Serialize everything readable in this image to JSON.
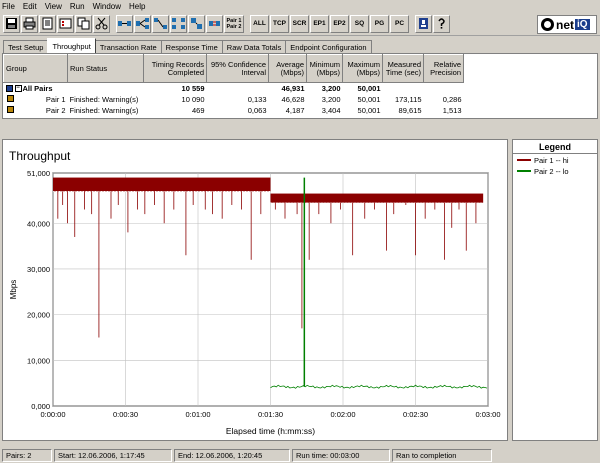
{
  "menu": [
    "File",
    "Edit",
    "View",
    "Run",
    "Window",
    "Help"
  ],
  "toolbar_text_buttons": [
    "ALL",
    "TCP",
    "SCR",
    "EP1",
    "EP2",
    "SQ",
    "PG",
    "PC"
  ],
  "toolbar_pair_button": [
    "Pair 1",
    "Pair 2"
  ],
  "logo": {
    "prefix": "net",
    "suffix": "iQ"
  },
  "tabs": [
    "Test Setup",
    "Throughput",
    "Transaction Rate",
    "Response Time",
    "Raw Data Totals",
    "Endpoint Configuration"
  ],
  "active_tab": "Throughput",
  "table": {
    "headers": [
      "Group",
      "Run Status",
      "Timing Records Completed",
      "95% Confidence Interval",
      "Average (Mbps)",
      "Minimum (Mbps)",
      "Maximum (Mbps)",
      "Measured Time (sec)",
      "Relative Precision"
    ],
    "rows": [
      {
        "group": "All Pairs",
        "status": "",
        "records": "10 559",
        "confidence": "",
        "average": "46,931",
        "minimum": "3,200",
        "maximum": "50,001",
        "time": "",
        "precision": ""
      },
      {
        "group": "Pair 1",
        "status": "Finished: Warning(s)",
        "records": "10 090",
        "confidence": "0,133",
        "average": "46,628",
        "minimum": "3,200",
        "maximum": "50,001",
        "time": "173,115",
        "precision": "0,286"
      },
      {
        "group": "Pair 2",
        "status": "Finished: Warning(s)",
        "records": "469",
        "confidence": "0,063",
        "average": "4,187",
        "minimum": "3,404",
        "maximum": "50,001",
        "time": "89,615",
        "precision": "1,513"
      }
    ]
  },
  "chart_data": {
    "type": "line",
    "title": "Throughput",
    "xlabel": "Elapsed time (h:mm:ss)",
    "ylabel": "Mbps",
    "ylim": [
      0,
      51000
    ],
    "xlim": [
      0,
      180
    ],
    "y_ticks": [
      "0,000",
      "10,000",
      "20,000",
      "30,000",
      "40,000",
      "51,000"
    ],
    "y_tick_values": [
      0,
      10000,
      20000,
      30000,
      40000,
      51000
    ],
    "x_ticks": [
      "0:00:00",
      "0:00:30",
      "0:01:00",
      "0:01:30",
      "0:02:00",
      "0:02:30",
      "0:03:00"
    ],
    "x_tick_values": [
      0,
      30,
      60,
      90,
      120,
      150,
      180
    ],
    "grid": true,
    "series": [
      {
        "name": "Pair 1 -- hi",
        "color": "#8b0000",
        "segments": [
          {
            "x_start": 0,
            "x_end": 90,
            "y_low": 47000,
            "y_high": 50000
          },
          {
            "x_start": 90,
            "x_end": 178,
            "y_low": 44500,
            "y_high": 46500
          }
        ],
        "dips": [
          [
            2,
            41000
          ],
          [
            4,
            44000
          ],
          [
            6,
            40000
          ],
          [
            9,
            37000
          ],
          [
            13,
            43000
          ],
          [
            16,
            42000
          ],
          [
            19,
            15000
          ],
          [
            24,
            41000
          ],
          [
            27,
            44000
          ],
          [
            31,
            38000
          ],
          [
            35,
            43000
          ],
          [
            38,
            42000
          ],
          [
            42,
            44000
          ],
          [
            46,
            40000
          ],
          [
            50,
            43000
          ],
          [
            55,
            33000
          ],
          [
            58,
            44000
          ],
          [
            63,
            43000
          ],
          [
            66,
            42000
          ],
          [
            70,
            41000
          ],
          [
            74,
            44000
          ],
          [
            78,
            43000
          ],
          [
            82,
            32000
          ],
          [
            86,
            42000
          ],
          [
            92,
            43000
          ],
          [
            96,
            41000
          ],
          [
            101,
            42000
          ],
          [
            103,
            17000
          ],
          [
            106,
            32000
          ],
          [
            110,
            42000
          ],
          [
            115,
            40000
          ],
          [
            119,
            43000
          ],
          [
            124,
            33000
          ],
          [
            129,
            41000
          ],
          [
            133,
            43000
          ],
          [
            138,
            34000
          ],
          [
            141,
            42000
          ],
          [
            146,
            44000
          ],
          [
            150,
            33000
          ],
          [
            154,
            41000
          ],
          [
            158,
            43000
          ],
          [
            162,
            32000
          ],
          [
            165,
            39000
          ],
          [
            168,
            43000
          ],
          [
            171,
            34000
          ],
          [
            175,
            40000
          ]
        ]
      },
      {
        "name": "Pair 2 -- lo",
        "color": "#008000",
        "x_start": 90,
        "x_end": 180,
        "y_base": 4200,
        "spikes": [
          [
            104,
            50001
          ]
        ]
      }
    ]
  },
  "legend_title": "Legend",
  "status": [
    "Pairs: 2",
    "Start: 12.06.2006, 1:17:45",
    "End: 12.06.2006, 1:20:45",
    "Run time: 00:03:00",
    "Ran to completion"
  ]
}
